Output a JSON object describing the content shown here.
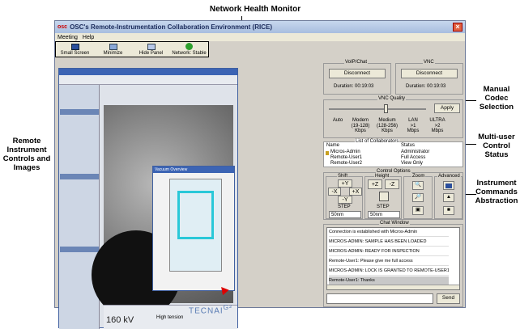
{
  "annotations": {
    "top": "Network Health Monitor",
    "codec": [
      "Manual",
      "Codec",
      "Selection"
    ],
    "collab": [
      "Multi-user",
      "Control",
      "Status"
    ],
    "commands": [
      "Instrument",
      "Commands",
      "Abstraction"
    ],
    "remote": [
      "Remote",
      "Instrument",
      "Controls and",
      "Images"
    ]
  },
  "window": {
    "title": "OSC's Remote-Instrumentation Collaboration Environment (RICE)",
    "menu": [
      "Meeting",
      "Help"
    ]
  },
  "toolbar": {
    "buttons": [
      {
        "label": "Small Screen",
        "icon": "monitor-icon"
      },
      {
        "label": "Minimize",
        "icon": "minimize-icon"
      },
      {
        "label": "Hide Panel",
        "icon": "panel-icon"
      },
      {
        "label": "Network: Stable",
        "icon": "network-status-icon",
        "color": "#2ea02e"
      }
    ]
  },
  "voip": {
    "title": "VoIP/Chat",
    "button": "Disconnect",
    "duration": "Duration: 00:19:03"
  },
  "vnc": {
    "title": "VNC",
    "button": "Disconnect",
    "duration": "Duration: 00:19:03"
  },
  "vnc_quality": {
    "title": "VNC Quality",
    "apply": "Apply",
    "options": [
      {
        "line1": "Auto",
        "line2": "",
        "line3": ""
      },
      {
        "line1": "Modem",
        "line2": "(19-128)",
        "line3": "Kbps"
      },
      {
        "line1": "Medium",
        "line2": "(128-256)",
        "line3": "Kbps"
      },
      {
        "line1": "LAN",
        "line2": ">1",
        "line3": "Mbps"
      },
      {
        "line1": "ULTRA",
        "line2": ">2",
        "line3": "Mbps"
      }
    ]
  },
  "collaborators": {
    "title": "List of Collaborators",
    "headers": [
      "Name",
      "Status"
    ],
    "rows": [
      {
        "name": "Micros-Admin",
        "status": "Administrator"
      },
      {
        "name": "Remote-User1",
        "status": "Full Access"
      },
      {
        "name": "Remote-User2",
        "status": "View Only"
      }
    ]
  },
  "control": {
    "title": "Control Options",
    "shift": {
      "title": "Shift",
      "up": "+Y",
      "left": "-X",
      "right": "+X",
      "down": "-Y",
      "step_label": "STEP",
      "step": "50nm"
    },
    "height": {
      "title": "Height",
      "up": "+Z",
      "down": "-Z",
      "step_label": "STEP",
      "step": "50nm"
    },
    "zoom": {
      "title": "Zoom"
    },
    "advanced": {
      "title": "Advanced"
    }
  },
  "chat": {
    "title": "Chat Window",
    "messages": [
      "Connection is established with Micros-Admin",
      "MICROS-ADMIN: SAMPLE HAS BEEN LOADED",
      "MICROS-ADMIN: READY FOR INSPECTION",
      "Remote-User1: Please give me full access",
      "MICROS-ADMIN: LOCK IS GRANTED TO REMOTE-USER1",
      "Remote-User1: Thanks"
    ],
    "send": "Send"
  },
  "remote_screen": {
    "kv": "160 kV",
    "mode": "High tension",
    "brand": "TECNAI",
    "brand_sup": "G²",
    "subwindow": "Vacuum Overview"
  }
}
